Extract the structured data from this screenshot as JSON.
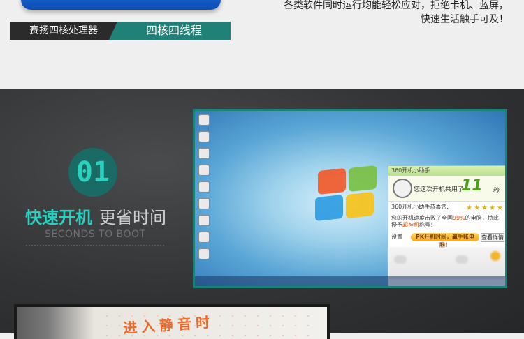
{
  "top": {
    "label_left": "赛扬四核处理器",
    "label_right": "四核四线程",
    "desc_line1": "各类软件同时运行均能轻松应对，拒绝卡机、蓝屏，",
    "desc_line2": "快速生活触手可及！"
  },
  "feature": {
    "number": "01",
    "title_strong": "快速开机",
    "title_light": "更省时间",
    "subtitle": "SECONDS TO BOOT"
  },
  "popup": {
    "header": "360开机小助手",
    "used_text": "您这次开机共用了",
    "seconds": "11",
    "unit": "秒",
    "congrats": "360开机小助手恭喜您:",
    "message_prefix": "您的开机速度击败了全国",
    "percent": "99%",
    "message_suffix": "的电脑，特此授予",
    "badge_name": "超神机",
    "badge_suffix": "称号！",
    "settings": "设置",
    "pk_button": "PK开机时间，赢手账电脑！",
    "detail_button": "查看详情"
  },
  "photo": {
    "text": "进入静音时"
  },
  "colors": {
    "accent_teal": "#2ad0c0",
    "teal_dark": "#1f8178",
    "bg_dark": "#323335"
  }
}
